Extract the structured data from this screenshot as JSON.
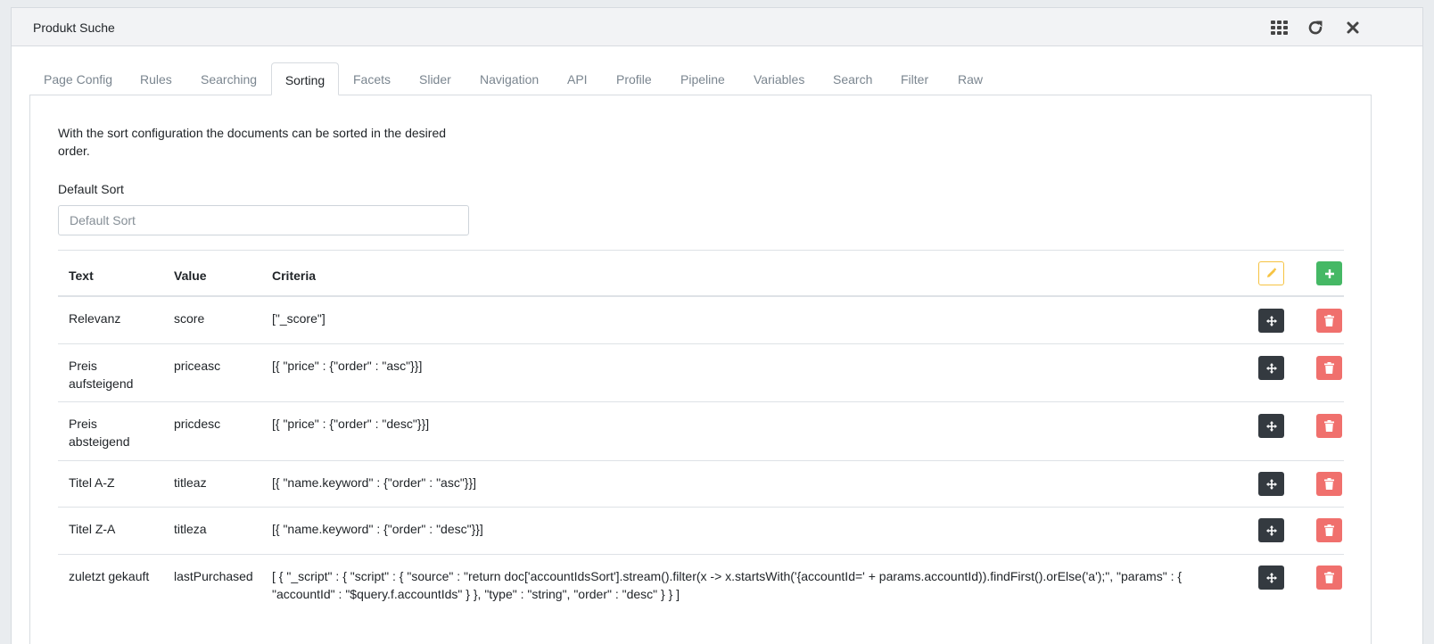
{
  "window": {
    "title": "Produkt Suche",
    "icons": [
      "grid-icon",
      "refresh-icon",
      "close-icon"
    ]
  },
  "tabs": [
    {
      "label": "Page Config"
    },
    {
      "label": "Rules"
    },
    {
      "label": "Searching"
    },
    {
      "label": "Sorting",
      "active": true
    },
    {
      "label": "Facets"
    },
    {
      "label": "Slider"
    },
    {
      "label": "Navigation"
    },
    {
      "label": "API"
    },
    {
      "label": "Profile"
    },
    {
      "label": "Pipeline"
    },
    {
      "label": "Variables"
    },
    {
      "label": "Search"
    },
    {
      "label": "Filter"
    },
    {
      "label": "Raw"
    }
  ],
  "sorting": {
    "description": "With the sort configuration the documents can be sorted in the desired order.",
    "default_sort_label": "Default Sort",
    "default_sort_placeholder": "Default Sort",
    "default_sort_value": "",
    "columns": {
      "text": "Text",
      "value": "Value",
      "criteria": "Criteria"
    },
    "rows": [
      {
        "text": "Relevanz",
        "value": "score",
        "criteria": "[\"_score\"]"
      },
      {
        "text": "Preis aufsteigend",
        "value": "priceasc",
        "criteria": "[{ \"price\" : {\"order\" : \"asc\"}}]"
      },
      {
        "text": "Preis absteigend",
        "value": "pricdesc",
        "criteria": "[{ \"price\" : {\"order\" : \"desc\"}}]"
      },
      {
        "text": "Titel A-Z",
        "value": "titleaz",
        "criteria": "[{ \"name.keyword\" : {\"order\" : \"asc\"}}]"
      },
      {
        "text": "Titel Z-A",
        "value": "titleza",
        "criteria": "[{ \"name.keyword\" : {\"order\" : \"desc\"}}]"
      },
      {
        "text": "zuletzt gekauft",
        "value": "lastPurchased",
        "criteria": "[ { \"_script\" : { \"script\" : { \"source\" : \"return doc['accountIdsSort'].stream().filter(x -> x.startsWith('{accountId=' + params.accountId)).findFirst().orElse('a');\", \"params\" : { \"accountId\" : \"$query.f.accountIds\" } }, \"type\" : \"string\", \"order\" : \"desc\" } } ]"
      }
    ],
    "row_icons": [
      "move-icon",
      "trash-icon"
    ],
    "header_icons": [
      "pencil-icon",
      "plus-icon"
    ]
  },
  "colors": {
    "move_button": "#343a40",
    "delete_button": "#f0706d",
    "edit_button_border": "#f6c342",
    "add_button": "#45b865"
  }
}
